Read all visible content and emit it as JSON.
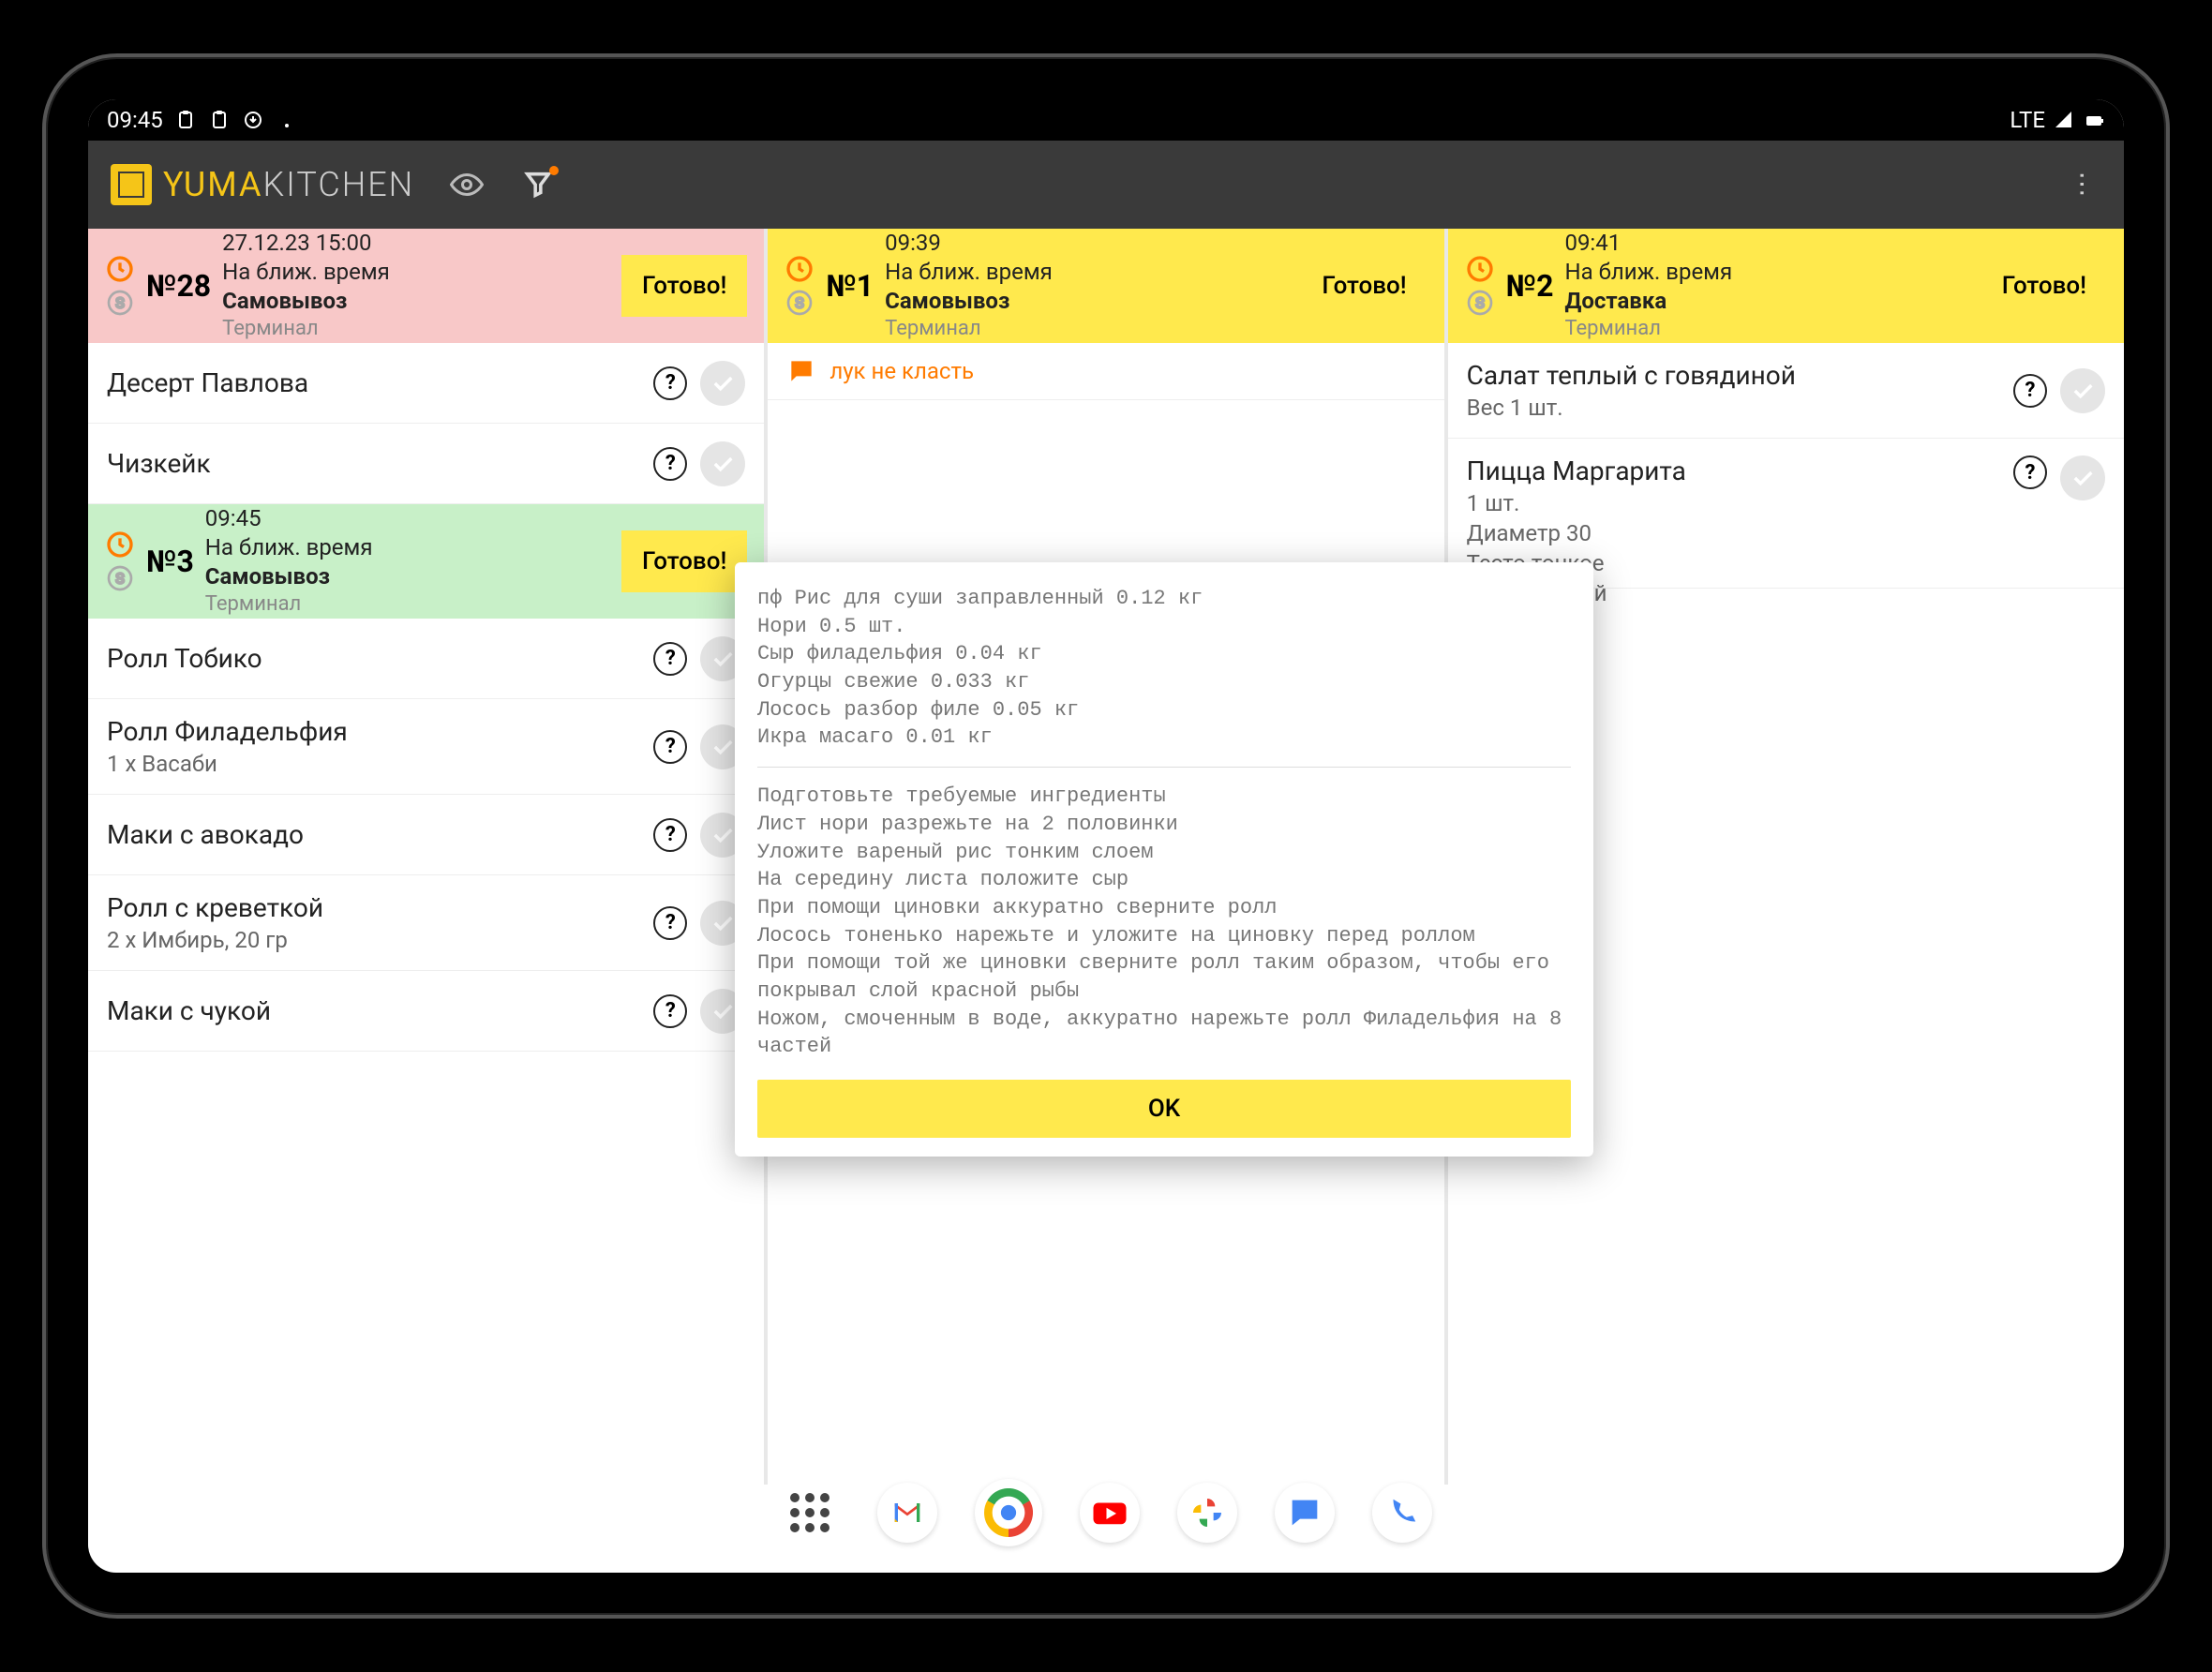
{
  "status": {
    "time": "09:45",
    "network": "LTE"
  },
  "app": {
    "title_a": "YUMA",
    "title_b": "KITCHEN"
  },
  "labels": {
    "ready": "Готово!"
  },
  "orders": [
    {
      "num": "№28",
      "datetime": "27.12.23 15:00",
      "slot": "На ближ. время",
      "type": "Самовывоз",
      "terminal": "Терминал",
      "items": [
        {
          "name": "Десерт Павлова"
        },
        {
          "name": "Чизкейк"
        }
      ]
    },
    {
      "num": "№1",
      "datetime": "09:39",
      "slot": "На ближ. время",
      "type": "Самовывоз",
      "terminal": "Терминал",
      "note": "лук не класть"
    },
    {
      "num": "№2",
      "datetime": "09:41",
      "slot": "На ближ. время",
      "type": "Доставка",
      "terminal": "Терминал",
      "items": [
        {
          "name": "Салат теплый с говядиной",
          "sub": "Вес 1 шт."
        },
        {
          "name": "Пицца Маргарита",
          "sub": "1 шт.",
          "sub2": "Диаметр 30",
          "sub3": "Тесто тонкое",
          "sub4": "Борт сырный"
        }
      ]
    },
    {
      "num": "№3",
      "datetime": "09:45",
      "slot": "На ближ. время",
      "type": "Самовывоз",
      "terminal": "Терминал",
      "items": [
        {
          "name": "Ролл Тобико"
        },
        {
          "name": "Ролл Филадельфия",
          "sub": "1 x Васаби"
        },
        {
          "name": "Маки с авокадо"
        },
        {
          "name": "Ролл с креветкой",
          "sub": "2 x Имбирь, 20 гр"
        },
        {
          "name": "Маки с чукой"
        }
      ]
    }
  ],
  "modal": {
    "ingredients": "пф Рис для суши заправленный 0.12 кг\nНори 0.5 шт.\nСыр филадельфия 0.04 кг\nОгурцы свежие 0.033 кг\nЛосось разбор филе 0.05 кг\nИкра масаго 0.01 кг",
    "steps": "Подготовьте требуемые ингредиенты\nЛист нори разрежьте на 2 половинки\nУложите вареный рис тонким слоем\nНа середину листа положите сыр\nПри помощи циновки аккуратно сверните ролл\nЛосось тоненько нарежьте и уложите на циновку перед роллом\nПри помощи той же циновки сверните ролл таким образом, чтобы его покрывал слой красной рыбы\nНожом, смоченным в воде, аккуратно нарежьте ролл Филадельфия на 8 частей",
    "ok": "OK"
  }
}
